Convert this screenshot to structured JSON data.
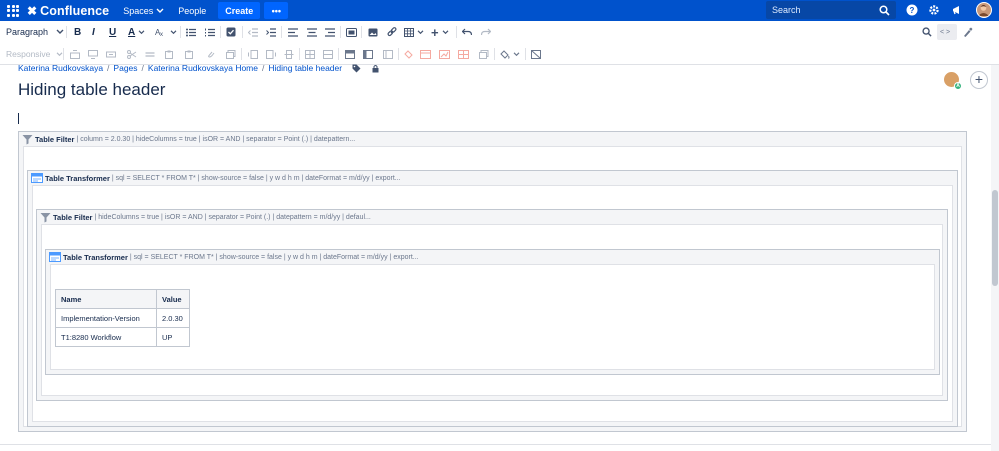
{
  "topnav": {
    "logo": "Confluence",
    "spaces": "Spaces",
    "people": "People",
    "create": "Create",
    "more": "•••",
    "search_placeholder": "Search"
  },
  "toolbar": {
    "paragraph": "Paragraph",
    "responsive": "Responsive",
    "bold": "B",
    "italic": "I",
    "underline": "U",
    "text_color": "A",
    "plus": "+",
    "source": "< >"
  },
  "breadcrumb": [
    "Katerina Rudkovskaya",
    "Pages",
    "Katerina Rudkovskaya Home",
    "Hiding table header"
  ],
  "page": {
    "title": "Hiding table header",
    "avatar_badge": "A"
  },
  "macros": {
    "filter_outer": {
      "name": "Table Filter",
      "params": "| column = 2.0.30 | hideColumns = true | isOR = AND | separator = Point (.) | datepattern..."
    },
    "transformer_outer": {
      "name": "Table Transformer",
      "params": "| sql = SELECT * FROM T* | show-source = false | y w d h m | dateFormat = m/d/yy | export..."
    },
    "filter_inner": {
      "name": "Table Filter",
      "params": "| hideColumns = true | isOR = AND | separator = Point (.) | datepattern = m/d/yy | defaul..."
    },
    "transformer_inner": {
      "name": "Table Transformer",
      "params": "| sql = SELECT * FROM T* | show-source = false | y w d h m | dateFormat = m/d/yy | export..."
    }
  },
  "table": {
    "headers": [
      "Name",
      "Value"
    ],
    "rows": [
      [
        "Implementation-Version",
        "2.0.30"
      ],
      [
        "T1:8280 Workflow",
        "UP"
      ]
    ]
  },
  "colors": {
    "nav_bg": "#0052cc",
    "create_bg": "#0065ff",
    "link": "#0052cc",
    "text": "#172b4d"
  }
}
